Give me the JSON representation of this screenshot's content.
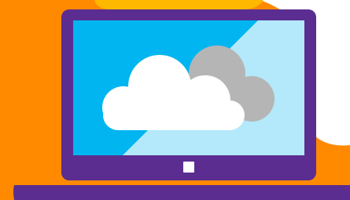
{
  "illustration": {
    "subject": "laptop-with-cloud",
    "colors": {
      "background_orange": "#FF8A00",
      "background_yellow": "#FFB800",
      "laptop_purple": "#5B2D91",
      "screen_blue": "#00B5F0",
      "screen_light_blue": "#B3E9FA",
      "cloud_white": "#FFFFFF",
      "cloud_gray": "#B5B5B5",
      "button_white": "#FFFFFF"
    },
    "icons": {
      "cloud_front": "cloud-icon",
      "cloud_back": "cloud-icon",
      "home_button": "square-button-icon"
    }
  }
}
